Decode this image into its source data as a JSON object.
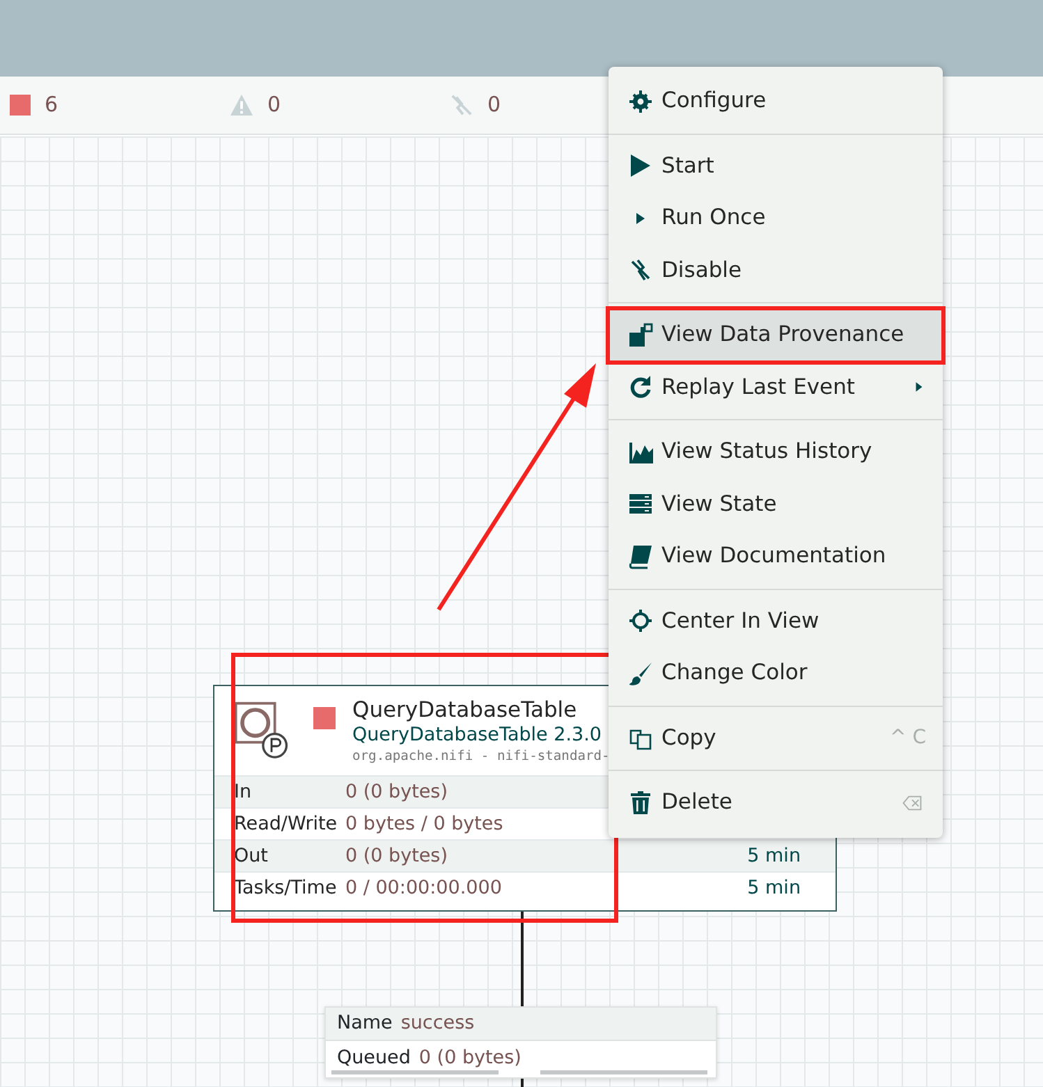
{
  "status_bar": [
    {
      "kind": "stopped",
      "count": "6"
    },
    {
      "kind": "invalid",
      "count": "0"
    },
    {
      "kind": "disabled",
      "count": "0"
    }
  ],
  "processor": {
    "name": "QueryDatabaseTable",
    "type": "QueryDatabaseTable 2.3.0",
    "bundle": "org.apache.nifi - nifi-standard-",
    "stats": [
      {
        "label": "In",
        "value": "0 (0 bytes)"
      },
      {
        "label": "Read/Write",
        "value": "0 bytes / 0 bytes"
      },
      {
        "label": "Out",
        "value": "0 (0 bytes)",
        "period": "5 min"
      },
      {
        "label": "Tasks/Time",
        "value": "0 / 00:00:00.000",
        "period": "5 min"
      }
    ]
  },
  "context_menu": {
    "groups": [
      [
        {
          "label": "Configure",
          "kind": "gear",
          "selected": false
        }
      ],
      [
        {
          "label": "Start",
          "kind": "play",
          "selected": false
        },
        {
          "label": "Run Once",
          "kind": "caret",
          "selected": false
        },
        {
          "label": "Disable",
          "kind": "disable",
          "selected": false
        }
      ],
      [
        {
          "label": "View Data Provenance",
          "kind": "provenance",
          "selected": true
        },
        {
          "label": "Replay Last Event",
          "kind": "replay",
          "selected": false,
          "submenu": true
        }
      ],
      [
        {
          "label": "View Status History",
          "kind": "chart",
          "selected": false
        },
        {
          "label": "View State",
          "kind": "state",
          "selected": false
        },
        {
          "label": "View Documentation",
          "kind": "book",
          "selected": false
        }
      ],
      [
        {
          "label": "Center In View",
          "kind": "crosshair",
          "selected": false
        },
        {
          "label": "Change Color",
          "kind": "brush",
          "selected": false
        }
      ],
      [
        {
          "label": "Copy",
          "kind": "copy",
          "selected": false,
          "shortcut": "^ C"
        }
      ],
      [
        {
          "label": "Delete",
          "kind": "trash",
          "selected": false
        }
      ]
    ]
  },
  "connection": {
    "name_label": "Name",
    "name": "success",
    "queued_label": "Queued",
    "queued": "0 (0 bytes)"
  }
}
